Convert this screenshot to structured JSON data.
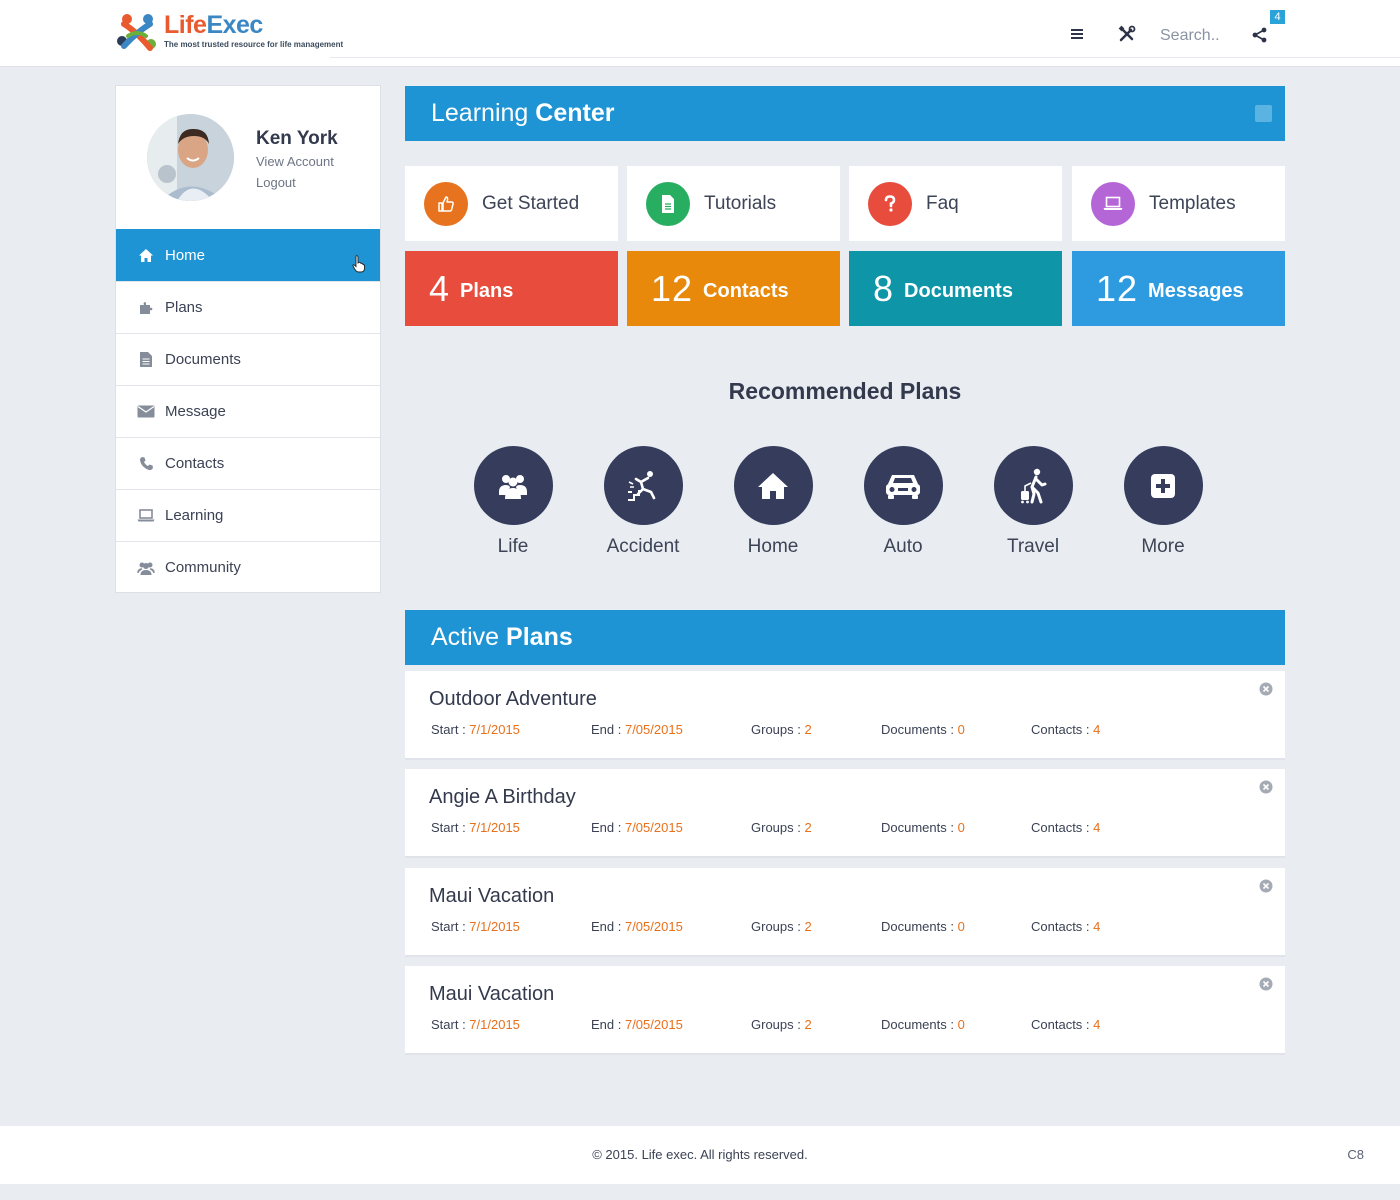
{
  "header": {
    "logo_name_a": "Life",
    "logo_name_b": "Exec",
    "logo_tagline": "The most trusted resource for life management",
    "search_placeholder": "Search..",
    "notification_count": "4"
  },
  "sidebar": {
    "profile": {
      "name": "Ken York",
      "view_account": "View Account",
      "logout": "Logout"
    },
    "items": [
      {
        "label": "Home",
        "icon": "home-icon",
        "active": true
      },
      {
        "label": "Plans",
        "icon": "puzzle-icon"
      },
      {
        "label": "Documents",
        "icon": "document-icon"
      },
      {
        "label": "Message",
        "icon": "envelope-icon"
      },
      {
        "label": "Contacts",
        "icon": "phone-icon"
      },
      {
        "label": "Learning",
        "icon": "laptop-icon"
      },
      {
        "label": "Community",
        "icon": "users-icon"
      }
    ]
  },
  "learning_center": {
    "title_light": "Learning",
    "title_bold": "Center",
    "quick_links": [
      {
        "label": "Get Started",
        "icon": "thumbs-up-icon",
        "color": "#e8731e"
      },
      {
        "label": "Tutorials",
        "icon": "file-icon",
        "color": "#27ae60"
      },
      {
        "label": "Faq",
        "icon": "question-icon",
        "color": "#e74c3c"
      },
      {
        "label": "Templates",
        "icon": "laptop-icon",
        "color": "#b566d6"
      }
    ],
    "stats": [
      {
        "count": "4",
        "label": "Plans",
        "color": "#e74c3c"
      },
      {
        "count": "12",
        "label": "Contacts",
        "color": "#e8890c"
      },
      {
        "count": "8",
        "label": "Documents",
        "color": "#0e95a8"
      },
      {
        "count": "12",
        "label": "Messages",
        "color": "#2e9be0"
      }
    ]
  },
  "recommended": {
    "title": "Recommended Plans",
    "items": [
      {
        "label": "Life",
        "icon": "family-icon"
      },
      {
        "label": "Accident",
        "icon": "falling-person-icon"
      },
      {
        "label": "Home",
        "icon": "home-icon"
      },
      {
        "label": "Auto",
        "icon": "car-icon"
      },
      {
        "label": "Travel",
        "icon": "traveler-icon"
      },
      {
        "label": "More",
        "icon": "plus-square-icon"
      }
    ]
  },
  "active_plans": {
    "title_light": "Active",
    "title_bold": "Plans",
    "labels": {
      "start": "Start : ",
      "end": "End : ",
      "groups": "Groups : ",
      "documents": "Documents : ",
      "contacts": "Contacts : "
    },
    "plans": [
      {
        "title": "Outdoor Adventure",
        "start": "7/1/2015",
        "end": "7/05/2015",
        "groups": "2",
        "documents": "0",
        "contacts": "4"
      },
      {
        "title": "Angie A Birthday",
        "start": "7/1/2015",
        "end": "7/05/2015",
        "groups": "2",
        "documents": "0",
        "contacts": "4"
      },
      {
        "title": "Maui Vacation",
        "start": "7/1/2015",
        "end": "7/05/2015",
        "groups": "2",
        "documents": "0",
        "contacts": "4"
      },
      {
        "title": "Maui Vacation",
        "start": "7/1/2015",
        "end": "7/05/2015",
        "groups": "2",
        "documents": "0",
        "contacts": "4"
      }
    ]
  },
  "footer": {
    "copyright": "© 2015. Life exec. All rights reserved.",
    "code": "C8"
  }
}
